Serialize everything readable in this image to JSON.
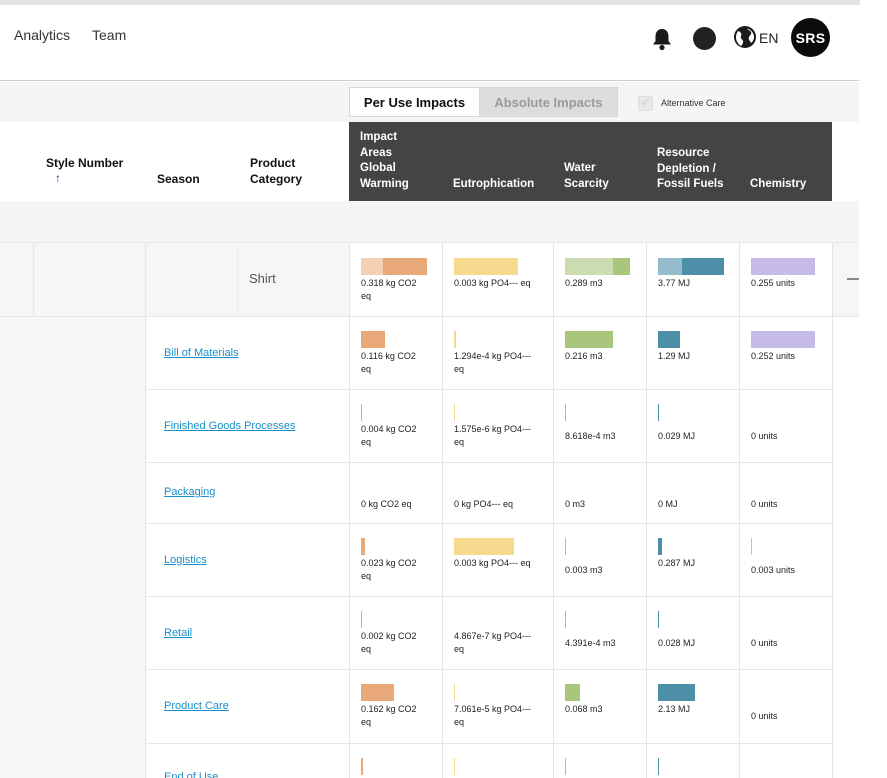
{
  "nav": {
    "analytics": "Analytics",
    "team": "Team",
    "language": "EN",
    "avatar_initials": "SRS"
  },
  "toggle": {
    "per_use": "Per Use Impacts",
    "absolute": "Absolute Impacts",
    "alt_care_label": "Alternative Care",
    "alt_care_checked": true
  },
  "columns": {
    "style_number": "Style Number",
    "sort_indicator": "↑",
    "season": "Season",
    "product_category_line1": "Product",
    "product_category_line2": "Category",
    "impact_areas": [
      "Impact",
      "Areas"
    ],
    "global_warming": [
      "Global",
      "Warming"
    ],
    "eutrophication": "Eutrophication",
    "water_scarcity": [
      "Water",
      "Scarcity"
    ],
    "resource_depletion": [
      "Resource",
      "Depletion /",
      "Fossil Fuels"
    ],
    "chemistry": "Chemistry"
  },
  "summary": {
    "category": "Shirt",
    "values": {
      "gw": [
        "0.318 kg CO2",
        "eq"
      ],
      "eu": [
        "0.003 kg PO4--- eq"
      ],
      "ws": [
        "0.289 m3"
      ],
      "rd": [
        "3.77 MJ"
      ],
      "ch": [
        "0.255 units"
      ]
    }
  },
  "colors": {
    "gw": "#e8a878",
    "eu": "#f5da8e",
    "ws": "#a8c77c",
    "rd": "#4e8fa8",
    "ch": "#c6bbe6",
    "header_bg": "#444444"
  },
  "stages": [
    {
      "name": "Bill of Materials",
      "gw": [
        "0.116 kg CO2",
        "eq"
      ],
      "eu": [
        "1.294e-4 kg PO4---",
        "eq"
      ],
      "ws": [
        "0.216 m3"
      ],
      "rd": [
        "1.29 MJ"
      ],
      "ch": [
        "0.252 units"
      ]
    },
    {
      "name": "Finished Goods Processes",
      "gw": [
        "0.004 kg CO2",
        "eq"
      ],
      "eu": [
        "1.575e-6 kg PO4---",
        "eq"
      ],
      "ws": [
        "8.618e-4 m3"
      ],
      "rd": [
        "0.029 MJ"
      ],
      "ch": [
        "0 units"
      ]
    },
    {
      "name": "Packaging",
      "gw": [
        "0 kg CO2 eq"
      ],
      "eu": [
        "0 kg PO4--- eq"
      ],
      "ws": [
        "0 m3"
      ],
      "rd": [
        "0 MJ"
      ],
      "ch": [
        "0 units"
      ]
    },
    {
      "name": "Logistics",
      "gw": [
        "0.023 kg CO2",
        "eq"
      ],
      "eu": [
        "0.003 kg PO4--- eq"
      ],
      "ws": [
        "0.003 m3"
      ],
      "rd": [
        "0.287 MJ"
      ],
      "ch": [
        "0.003 units"
      ]
    },
    {
      "name": "Retail",
      "gw": [
        "0.002 kg CO2",
        "eq"
      ],
      "eu": [
        "4.867e-7 kg PO4---",
        "eq"
      ],
      "ws": [
        "4.391e-4 m3"
      ],
      "rd": [
        "0.028 MJ"
      ],
      "ch": [
        "0 units"
      ]
    },
    {
      "name": "Product Care",
      "gw": [
        "0.162 kg CO2",
        "eq"
      ],
      "eu": [
        "7.061e-5 kg PO4---",
        "eq"
      ],
      "ws": [
        "0.068 m3"
      ],
      "rd": [
        "2.13 MJ"
      ],
      "ch": [
        "0 units"
      ]
    },
    {
      "name": "End of Use",
      "gw": [],
      "eu": [],
      "ws": [],
      "rd": [],
      "ch": []
    }
  ]
}
